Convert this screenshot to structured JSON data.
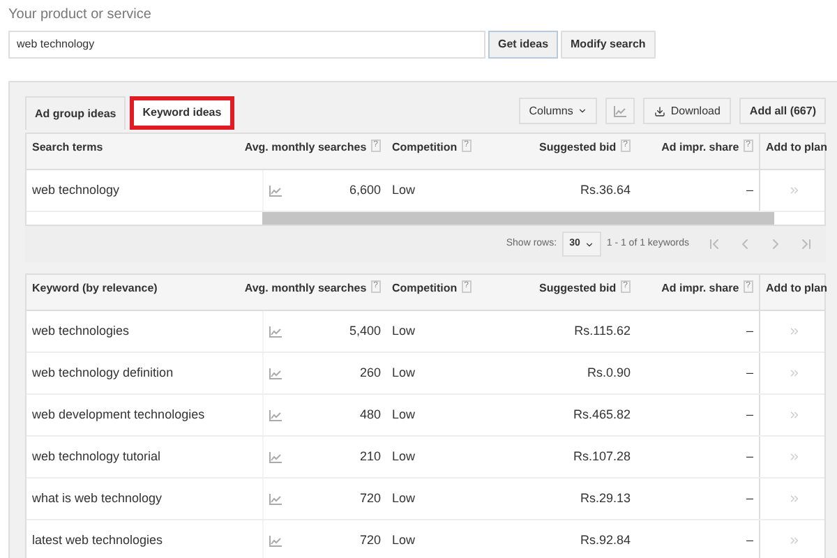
{
  "search": {
    "label": "Your product or service",
    "value": "web technology",
    "buttons": [
      "Get ideas",
      "Modify search"
    ]
  },
  "tabs": [
    {
      "label": "Ad group ideas",
      "selected": false,
      "highlighted": false
    },
    {
      "label": "Keyword ideas",
      "selected": true,
      "highlighted": true
    }
  ],
  "toolbar": {
    "columns": "Columns",
    "download": "Download",
    "add_all": "Add all (667)"
  },
  "search_terms_table": {
    "columns": [
      {
        "label": "Search terms"
      },
      {
        "label": "Avg. monthly searches",
        "help": "?"
      },
      {
        "label": "Competition",
        "help": "?"
      },
      {
        "label": "Suggested bid",
        "help": "?"
      },
      {
        "label": "Ad impr. share",
        "help": "?"
      },
      {
        "label": "Add to plan"
      }
    ],
    "rows": [
      {
        "keyword": "web technology",
        "searches": "6,600",
        "competition": "Low",
        "bid": "Rs.36.64",
        "share": "–"
      }
    ]
  },
  "pagination": {
    "label": "Show rows:",
    "rows": "30",
    "range": "1 - 1 of 1 keywords"
  },
  "keyword_table": {
    "columns": [
      {
        "label": "Keyword (by relevance)"
      },
      {
        "label": "Avg. monthly searches",
        "help": "?"
      },
      {
        "label": "Competition",
        "help": "?"
      },
      {
        "label": "Suggested bid",
        "help": "?"
      },
      {
        "label": "Ad impr. share",
        "help": "?"
      },
      {
        "label": "Add to plan"
      }
    ],
    "rows": [
      {
        "keyword": "web technologies",
        "searches": "5,400",
        "competition": "Low",
        "bid": "Rs.115.62",
        "share": "–"
      },
      {
        "keyword": "web technology definition",
        "searches": "260",
        "competition": "Low",
        "bid": "Rs.0.90",
        "share": "–"
      },
      {
        "keyword": "web development technologies",
        "searches": "480",
        "competition": "Low",
        "bid": "Rs.465.82",
        "share": "–"
      },
      {
        "keyword": "web technology tutorial",
        "searches": "210",
        "competition": "Low",
        "bid": "Rs.107.28",
        "share": "–"
      },
      {
        "keyword": "what is web technology",
        "searches": "720",
        "competition": "Low",
        "bid": "Rs.29.13",
        "share": "–"
      },
      {
        "keyword": "latest web technologies",
        "searches": "720",
        "competition": "Low",
        "bid": "Rs.92.84",
        "share": "–"
      }
    ]
  }
}
